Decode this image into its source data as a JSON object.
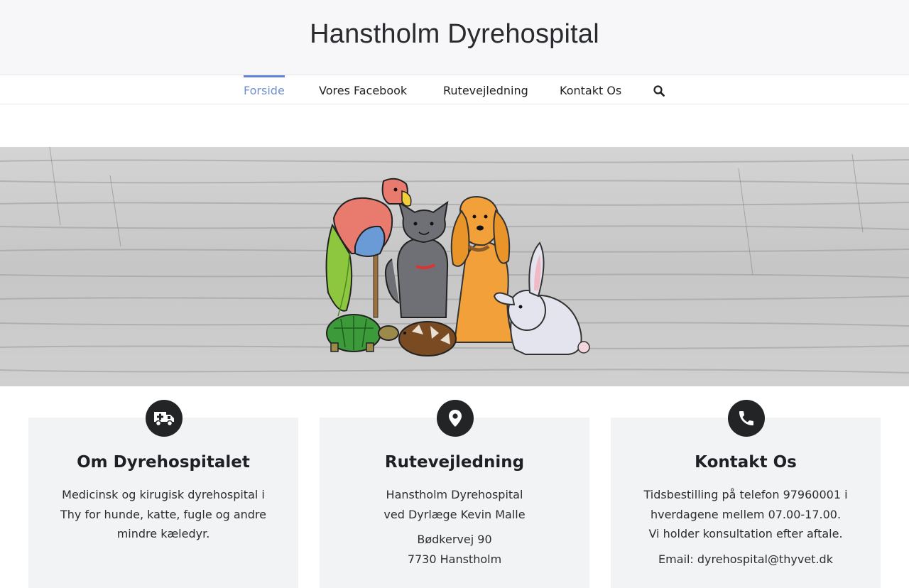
{
  "site": {
    "title": "Hanstholm Dyrehospital"
  },
  "nav": {
    "items": [
      "Forside",
      "Vores Facebook",
      "Rutevejledning",
      "Kontakt Os"
    ],
    "active": "Forside"
  },
  "icons": {
    "search": "search-icon",
    "card1": "ambulance-icon",
    "card2": "map-marker-icon",
    "card3": "phone-icon"
  },
  "colors": {
    "accent": "#5f84d6",
    "icon_bg": "#222426",
    "card_bg": "#f2f3f5"
  },
  "cards": [
    {
      "title": "Om Dyrehospitalet",
      "lines": [
        "Medicinsk og kirugisk dyrehospital i",
        "Thy for hunde, katte, fugle og andre",
        "mindre kæledyr."
      ]
    },
    {
      "title": "Rutevejledning",
      "lines": [
        "Hanstholm Dyrehospital",
        "ved Dyrlæge Kevin Malle"
      ],
      "lines2": [
        "Bødkervej 90",
        "7730 Hanstholm"
      ]
    },
    {
      "title": "Kontakt Os",
      "lines": [
        "Tidsbestilling på telefon 97960001 i",
        "hverdagene mellem 07.00-17.00.",
        "Vi holder konsultation efter aftale."
      ],
      "lines2": [
        "Email: dyrehospital@thyvet.dk"
      ]
    }
  ]
}
